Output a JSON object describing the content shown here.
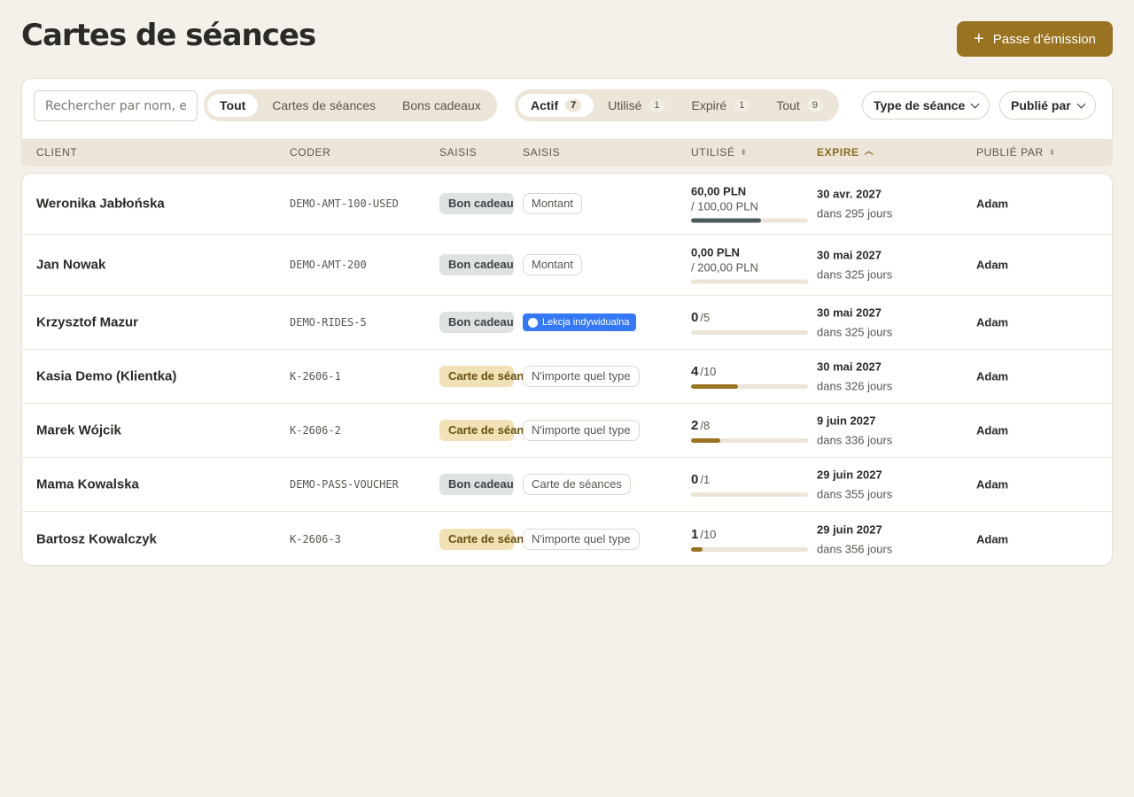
{
  "page": {
    "title": "Cartes de séances",
    "primary_button": "Passe d'émission"
  },
  "search": {
    "placeholder": "Rechercher par nom, e-"
  },
  "type_filter": {
    "items": [
      {
        "label": "Tout",
        "active": true
      },
      {
        "label": "Cartes de séances",
        "active": false
      },
      {
        "label": "Bons cadeaux",
        "active": false
      }
    ]
  },
  "status_filter": {
    "items": [
      {
        "label": "Actif",
        "count": "7",
        "active": true
      },
      {
        "label": "Utilisé",
        "count": "1",
        "active": false
      },
      {
        "label": "Expiré",
        "count": "1",
        "active": false
      },
      {
        "label": "Tout",
        "count": "9",
        "active": false
      }
    ]
  },
  "dropdowns": {
    "session_type": "Type de séance",
    "published_by": "Publié par"
  },
  "columns": {
    "client": "CLIENT",
    "code": "CODER",
    "type": "SAISIS",
    "scope": "SAISIS",
    "used": "UTILISÉ",
    "expires": "EXPIRE",
    "published_by": "PUBLIÉ PAR"
  },
  "rows": [
    {
      "client": "Weronika Jabłońska",
      "code": "DEMO-AMT-100-USED",
      "type": "Bon cadeau",
      "kind": "gift",
      "scope": "Montant",
      "scope_style": "plain",
      "used_amount": "60,00 PLN",
      "used_total": "/ 100,00 PLN",
      "progress": 0.6,
      "expires": "30 avr. 2027",
      "expires_rel": "dans 295 jours",
      "published_by": "Adam"
    },
    {
      "client": "Jan Nowak",
      "code": "DEMO-AMT-200",
      "type": "Bon cadeau",
      "kind": "gift",
      "scope": "Montant",
      "scope_style": "plain",
      "used_amount": "0,00 PLN",
      "used_total": "/ 200,00 PLN",
      "progress": 0,
      "expires": "30 mai 2027",
      "expires_rel": "dans 325 jours",
      "published_by": "Adam"
    },
    {
      "client": "Krzysztof Mazur",
      "code": "DEMO-RIDES-5",
      "type": "Bon cadeau",
      "kind": "gift",
      "scope": "Lekcja indywidualna",
      "scope_style": "blue",
      "used_count": "0",
      "used_of": "/5",
      "progress": 0,
      "expires": "30 mai 2027",
      "expires_rel": "dans 325 jours",
      "published_by": "Adam"
    },
    {
      "client": "Kasia Demo (Klientka)",
      "code": "K-2606-1",
      "type": "Carte de séances",
      "kind": "pass",
      "scope": "N'importe quel type",
      "scope_style": "plain",
      "used_count": "4",
      "used_of": "/10",
      "progress": 0.4,
      "expires": "30 mai 2027",
      "expires_rel": "dans 326 jours",
      "published_by": "Adam"
    },
    {
      "client": "Marek Wójcik",
      "code": "K-2606-2",
      "type": "Carte de séances",
      "kind": "pass",
      "scope": "N'importe quel type",
      "scope_style": "plain",
      "used_count": "2",
      "used_of": "/8",
      "progress": 0.25,
      "expires": "9 juin 2027",
      "expires_rel": "dans 336 jours",
      "published_by": "Adam"
    },
    {
      "client": "Mama Kowalska",
      "code": "DEMO-PASS-VOUCHER",
      "type": "Bon cadeau",
      "kind": "gift",
      "scope": "Carte de séances",
      "scope_style": "plain",
      "used_count": "0",
      "used_of": "/1",
      "progress": 0,
      "expires": "29 juin 2027",
      "expires_rel": "dans 355 jours",
      "published_by": "Adam"
    },
    {
      "client": "Bartosz Kowalczyk",
      "code": "K-2606-3",
      "type": "Carte de séances",
      "kind": "pass",
      "scope": "N'importe quel type",
      "scope_style": "plain",
      "used_count": "1",
      "used_of": "/10",
      "progress": 0.1,
      "expires": "29 juin 2027",
      "expires_rel": "dans 356 jours",
      "published_by": "Adam"
    }
  ],
  "colors": {
    "accent": "#9a7320",
    "background": "#f4f1ea",
    "gift_badge": "#dfe2e3",
    "pass_badge": "#f1e2b5",
    "scope_blue": "#3478f6"
  }
}
